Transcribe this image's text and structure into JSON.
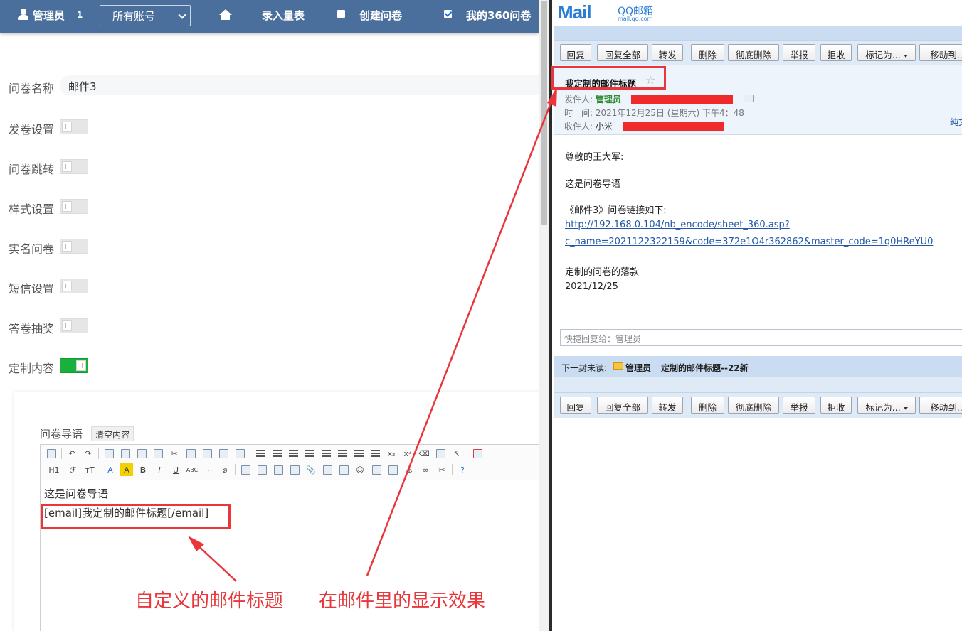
{
  "topbar": {
    "user_label": "管理员",
    "badge": "1",
    "account_select": "所有账号",
    "nav_record": "录入量表",
    "nav_create": "创建问卷",
    "nav_my360": "我的360问卷"
  },
  "form": {
    "name_label": "问卷名称",
    "name_value": "邮件3",
    "settings": [
      {
        "label": "发卷设置",
        "on": false
      },
      {
        "label": "问卷跳转",
        "on": false
      },
      {
        "label": "样式设置",
        "on": false
      },
      {
        "label": "实名问卷",
        "on": false
      },
      {
        "label": "短信设置",
        "on": false
      },
      {
        "label": "答卷抽奖",
        "on": false
      },
      {
        "label": "定制内容",
        "on": true
      }
    ]
  },
  "editor": {
    "guide_label": "问卷导语",
    "clear_button": "清空内容",
    "heading_button": "H1",
    "line1": "这是问卷导语",
    "line2": "[email]我定制的邮件标题[/email]"
  },
  "mail": {
    "logo_mail": "Mail",
    "logo_qq": "QQ邮箱",
    "logo_url": "mail.qq.com",
    "buttons": [
      "回复",
      "回复全部",
      "转发",
      "删除",
      "彻底删除",
      "举报",
      "拒收",
      "标记为...",
      "移动到..."
    ],
    "subject": "我定制的邮件标题",
    "sender_label": "发件人:",
    "sender_name": "管理员",
    "time_label": "时　间:",
    "time_value": "2021年12月25日 (星期六) 下午4：48",
    "recipient_label": "收件人:",
    "recipient_name": "小米",
    "plain_text_link": "纯文",
    "body": {
      "greeting": "尊敬的王大军:",
      "intro": "这是问卷导语",
      "link_intro": "《邮件3》问卷链接如下:",
      "link_line1": "http://192.168.0.104/nb_encode/sheet_360.asp?",
      "link_line2": "c_name=2021122322159&code=372e1O4r362862&master_code=1q0HReYU0",
      "footer": "定制的问卷的落款",
      "date": "2021/12/25"
    },
    "quick_reply_placeholder": "快捷回复给：管理员",
    "next_unread_label": "下一封未读:",
    "next_unread_sender": "管理员",
    "next_unread_subject": "定制的邮件标题--22新"
  },
  "annotations": {
    "left_caption": "自定义的邮件标题",
    "right_caption": "在邮件里的显示效果",
    "color": "#e8363a"
  }
}
